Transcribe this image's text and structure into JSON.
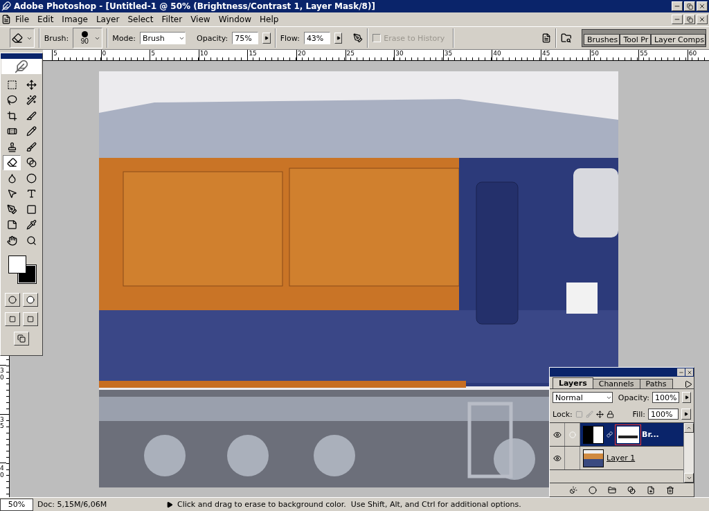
{
  "window": {
    "title": "Adobe Photoshop - [Untitled-1 @ 50% (Brightness/Contrast 1, Layer Mask/8)]"
  },
  "menu": [
    "File",
    "Edit",
    "Image",
    "Layer",
    "Select",
    "Filter",
    "View",
    "Window",
    "Help"
  ],
  "options": {
    "brush_label": "Brush:",
    "brush_size": "90",
    "mode_label": "Mode:",
    "mode": "Brush",
    "opacity_label": "Opacity:",
    "opacity": "75%",
    "flow_label": "Flow:",
    "flow": "43%",
    "erase_to_history": {
      "label": "Erase to History",
      "checked": false,
      "disabled": true
    }
  },
  "palette_well": [
    {
      "label": "Brushes"
    },
    {
      "label": "Tool Pr"
    },
    {
      "label": "Layer Comps"
    }
  ],
  "ruler": {
    "horizontal": [
      "5",
      "0",
      "5",
      "10",
      "15",
      "20",
      "25",
      "30",
      "35",
      "40",
      "45",
      "50",
      "55",
      "60"
    ],
    "vertical": [
      "30",
      "35",
      "40"
    ]
  },
  "tools": [
    {
      "selected": false
    },
    {
      "selected": false
    },
    {
      "selected": false
    },
    {
      "selected": false
    },
    {
      "selected": false
    },
    {
      "selected": false
    },
    {
      "selected": false
    },
    {
      "selected": false
    },
    {
      "selected": false
    },
    {
      "selected": false
    },
    {
      "selected": true
    },
    {
      "selected": false
    },
    {
      "selected": false
    },
    {
      "selected": false
    },
    {
      "selected": false
    },
    {
      "selected": false
    },
    {
      "selected": false
    },
    {
      "selected": false
    },
    {
      "selected": false
    },
    {
      "selected": false
    },
    {
      "selected": false
    },
    {
      "selected": false
    }
  ],
  "layers_panel": {
    "tabs": [
      {
        "label": "Layers",
        "selected": true
      },
      {
        "label": "Channels",
        "selected": false
      },
      {
        "label": "Paths",
        "selected": false
      }
    ],
    "blend_mode": "Normal",
    "opacity_label": "Opacity:",
    "opacity": "100%",
    "lock_label": "Lock:",
    "fill_label": "Fill:",
    "fill": "100%",
    "layers": [
      {
        "name": "Br...",
        "kind": "adjustment",
        "selected": true,
        "visible": true
      },
      {
        "name": "Layer 1",
        "kind": "pixel",
        "selected": false,
        "visible": true
      }
    ]
  },
  "status_bar": {
    "zoom": "50%",
    "doc": "Doc: 5,15M/6,06M",
    "hint": "Click and drag to erase to background color.  Use Shift, Alt, and Ctrl for additional options."
  }
}
